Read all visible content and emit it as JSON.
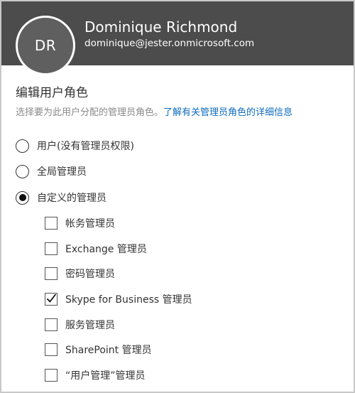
{
  "header": {
    "avatar_initials": "DR",
    "name": "Dominique Richmond",
    "email": "dominique@jester.onmicrosoft.com"
  },
  "form": {
    "title": "编辑用户角色",
    "description": "选择要为此用户分配的管理员角色。",
    "learn_more_link": "了解有关管理员角色的详细信息",
    "roles": [
      {
        "label": "用户(没有管理员权限)",
        "selected": false
      },
      {
        "label": "全局管理员",
        "selected": false
      },
      {
        "label": "自定义的管理员",
        "selected": true
      }
    ],
    "custom_roles": [
      {
        "label": "帐务管理员",
        "checked": false
      },
      {
        "label": "Exchange 管理员",
        "checked": false
      },
      {
        "label": "密码管理员",
        "checked": false
      },
      {
        "label": "Skype for Business 管理员",
        "checked": true
      },
      {
        "label": "服务管理员",
        "checked": false
      },
      {
        "label": "SharePoint 管理员",
        "checked": false
      },
      {
        "label": "“用户管理”管理员",
        "checked": false
      }
    ]
  },
  "colors": {
    "header_bg": "#4c4c4c",
    "link": "#0f6cbd"
  }
}
